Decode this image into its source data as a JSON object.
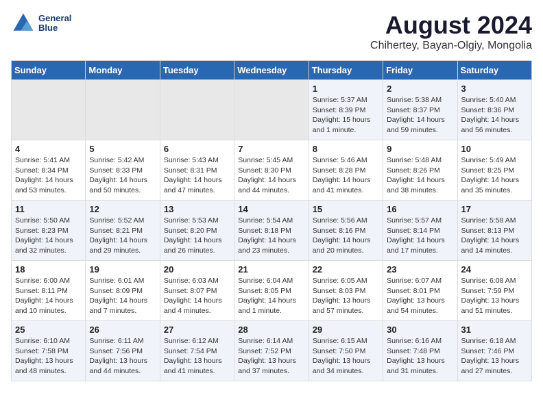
{
  "header": {
    "logo_line1": "General",
    "logo_line2": "Blue",
    "main_title": "August 2024",
    "subtitle": "Chihertey, Bayan-Olgiy, Mongolia"
  },
  "days_of_week": [
    "Sunday",
    "Monday",
    "Tuesday",
    "Wednesday",
    "Thursday",
    "Friday",
    "Saturday"
  ],
  "weeks": [
    [
      {
        "day": "",
        "info": ""
      },
      {
        "day": "",
        "info": ""
      },
      {
        "day": "",
        "info": ""
      },
      {
        "day": "",
        "info": ""
      },
      {
        "day": "1",
        "info": "Sunrise: 5:37 AM\nSunset: 8:39 PM\nDaylight: 15 hours\nand 1 minute."
      },
      {
        "day": "2",
        "info": "Sunrise: 5:38 AM\nSunset: 8:37 PM\nDaylight: 14 hours\nand 59 minutes."
      },
      {
        "day": "3",
        "info": "Sunrise: 5:40 AM\nSunset: 8:36 PM\nDaylight: 14 hours\nand 56 minutes."
      }
    ],
    [
      {
        "day": "4",
        "info": "Sunrise: 5:41 AM\nSunset: 8:34 PM\nDaylight: 14 hours\nand 53 minutes."
      },
      {
        "day": "5",
        "info": "Sunrise: 5:42 AM\nSunset: 8:33 PM\nDaylight: 14 hours\nand 50 minutes."
      },
      {
        "day": "6",
        "info": "Sunrise: 5:43 AM\nSunset: 8:31 PM\nDaylight: 14 hours\nand 47 minutes."
      },
      {
        "day": "7",
        "info": "Sunrise: 5:45 AM\nSunset: 8:30 PM\nDaylight: 14 hours\nand 44 minutes."
      },
      {
        "day": "8",
        "info": "Sunrise: 5:46 AM\nSunset: 8:28 PM\nDaylight: 14 hours\nand 41 minutes."
      },
      {
        "day": "9",
        "info": "Sunrise: 5:48 AM\nSunset: 8:26 PM\nDaylight: 14 hours\nand 38 minutes."
      },
      {
        "day": "10",
        "info": "Sunrise: 5:49 AM\nSunset: 8:25 PM\nDaylight: 14 hours\nand 35 minutes."
      }
    ],
    [
      {
        "day": "11",
        "info": "Sunrise: 5:50 AM\nSunset: 8:23 PM\nDaylight: 14 hours\nand 32 minutes."
      },
      {
        "day": "12",
        "info": "Sunrise: 5:52 AM\nSunset: 8:21 PM\nDaylight: 14 hours\nand 29 minutes."
      },
      {
        "day": "13",
        "info": "Sunrise: 5:53 AM\nSunset: 8:20 PM\nDaylight: 14 hours\nand 26 minutes."
      },
      {
        "day": "14",
        "info": "Sunrise: 5:54 AM\nSunset: 8:18 PM\nDaylight: 14 hours\nand 23 minutes."
      },
      {
        "day": "15",
        "info": "Sunrise: 5:56 AM\nSunset: 8:16 PM\nDaylight: 14 hours\nand 20 minutes."
      },
      {
        "day": "16",
        "info": "Sunrise: 5:57 AM\nSunset: 8:14 PM\nDaylight: 14 hours\nand 17 minutes."
      },
      {
        "day": "17",
        "info": "Sunrise: 5:58 AM\nSunset: 8:13 PM\nDaylight: 14 hours\nand 14 minutes."
      }
    ],
    [
      {
        "day": "18",
        "info": "Sunrise: 6:00 AM\nSunset: 8:11 PM\nDaylight: 14 hours\nand 10 minutes."
      },
      {
        "day": "19",
        "info": "Sunrise: 6:01 AM\nSunset: 8:09 PM\nDaylight: 14 hours\nand 7 minutes."
      },
      {
        "day": "20",
        "info": "Sunrise: 6:03 AM\nSunset: 8:07 PM\nDaylight: 14 hours\nand 4 minutes."
      },
      {
        "day": "21",
        "info": "Sunrise: 6:04 AM\nSunset: 8:05 PM\nDaylight: 14 hours\nand 1 minute."
      },
      {
        "day": "22",
        "info": "Sunrise: 6:05 AM\nSunset: 8:03 PM\nDaylight: 13 hours\nand 57 minutes."
      },
      {
        "day": "23",
        "info": "Sunrise: 6:07 AM\nSunset: 8:01 PM\nDaylight: 13 hours\nand 54 minutes."
      },
      {
        "day": "24",
        "info": "Sunrise: 6:08 AM\nSunset: 7:59 PM\nDaylight: 13 hours\nand 51 minutes."
      }
    ],
    [
      {
        "day": "25",
        "info": "Sunrise: 6:10 AM\nSunset: 7:58 PM\nDaylight: 13 hours\nand 48 minutes."
      },
      {
        "day": "26",
        "info": "Sunrise: 6:11 AM\nSunset: 7:56 PM\nDaylight: 13 hours\nand 44 minutes."
      },
      {
        "day": "27",
        "info": "Sunrise: 6:12 AM\nSunset: 7:54 PM\nDaylight: 13 hours\nand 41 minutes."
      },
      {
        "day": "28",
        "info": "Sunrise: 6:14 AM\nSunset: 7:52 PM\nDaylight: 13 hours\nand 37 minutes."
      },
      {
        "day": "29",
        "info": "Sunrise: 6:15 AM\nSunset: 7:50 PM\nDaylight: 13 hours\nand 34 minutes."
      },
      {
        "day": "30",
        "info": "Sunrise: 6:16 AM\nSunset: 7:48 PM\nDaylight: 13 hours\nand 31 minutes."
      },
      {
        "day": "31",
        "info": "Sunrise: 6:18 AM\nSunset: 7:46 PM\nDaylight: 13 hours\nand 27 minutes."
      }
    ]
  ]
}
